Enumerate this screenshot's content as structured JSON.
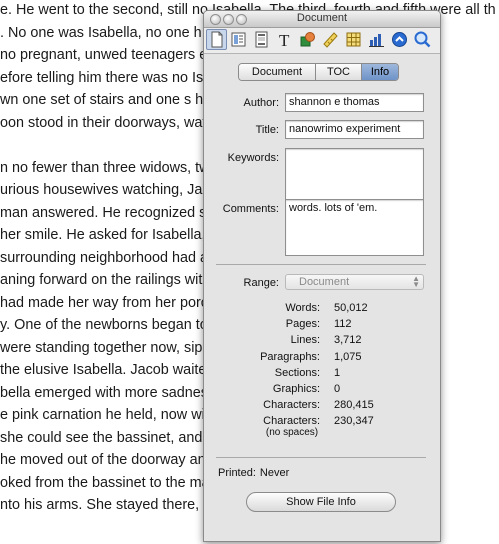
{
  "document_lines": [
    "e. He went to the second, still no Isabella. The third, fourth and fifth were all th",
    ". No one was Isabella, no one h                                  hey all kne",
    "no pregnant, unwed teenagers                                    ed him fo",
    "efore telling him there was no Isaba                            the bassin",
    "wn one set of stairs and one s                                   houses he",
    "oon stood in their doorways, wato                               way down t",
    "",
    "n no fewer than three widows, tw                                ee bachelo",
    "urious housewives watching, Jaco                                on the blo",
    "man answered. He recognized s                                   itten into t",
    "her smile. He asked for Isabella, a",
    " surrounding neighborhood had a                                  stood on th",
    "aning forward on the railings with                              h particula",
    "had made her way from her porc                                  ed the sce",
    "y. One of the newborns began to                                 watching. T",
    "were standing together now, sipp                                which hou",
    " the elusive Isabella. Jacob waited.",
    "bella emerged with more sadness                                 e glanced",
    "e pink carnation he held, now wil                               moved out",
    " she could see the bassinet, and                                widened w",
    "he moved out of the doorway and                                 ookers cou",
    "oked from the bassinet to the ma                                ed him fore",
    "nto his arms. She stayed there, th"
  ],
  "palette": {
    "title": "Document",
    "toolbar_icons": [
      "document-icon",
      "layout-icon",
      "header-footer-icon",
      "text-icon",
      "shapes-icon",
      "ruler-icon",
      "table-icon",
      "chart-icon",
      "link-icon",
      "zoom-icon"
    ],
    "tabs": [
      {
        "label": "Document",
        "active": false
      },
      {
        "label": "TOC",
        "active": false
      },
      {
        "label": "Info",
        "active": true
      }
    ],
    "fields": {
      "author_label": "Author:",
      "author_value": "shannon e thomas",
      "title_label": "Title:",
      "title_value": "nanowrimo experiment",
      "keywords_label": "Keywords:",
      "keywords_value": "",
      "comments_label": "Comments:",
      "comments_value": "words. lots of 'em."
    },
    "range_label": "Range:",
    "range_value": "Document",
    "stats": [
      {
        "label": "Words:",
        "value": "50,012"
      },
      {
        "label": "Pages:",
        "value": "112"
      },
      {
        "label": "Lines:",
        "value": "3,712"
      },
      {
        "label": "Paragraphs:",
        "value": "1,075"
      },
      {
        "label": "Sections:",
        "value": "1"
      },
      {
        "label": "Graphics:",
        "value": "0"
      },
      {
        "label": "Characters:",
        "value": "280,415"
      },
      {
        "label": "Characters:",
        "value": "230,347"
      }
    ],
    "stats_sub_label": "(no spaces)",
    "printed_label": "Printed:",
    "printed_value": "Never",
    "show_file_info": "Show File Info"
  }
}
